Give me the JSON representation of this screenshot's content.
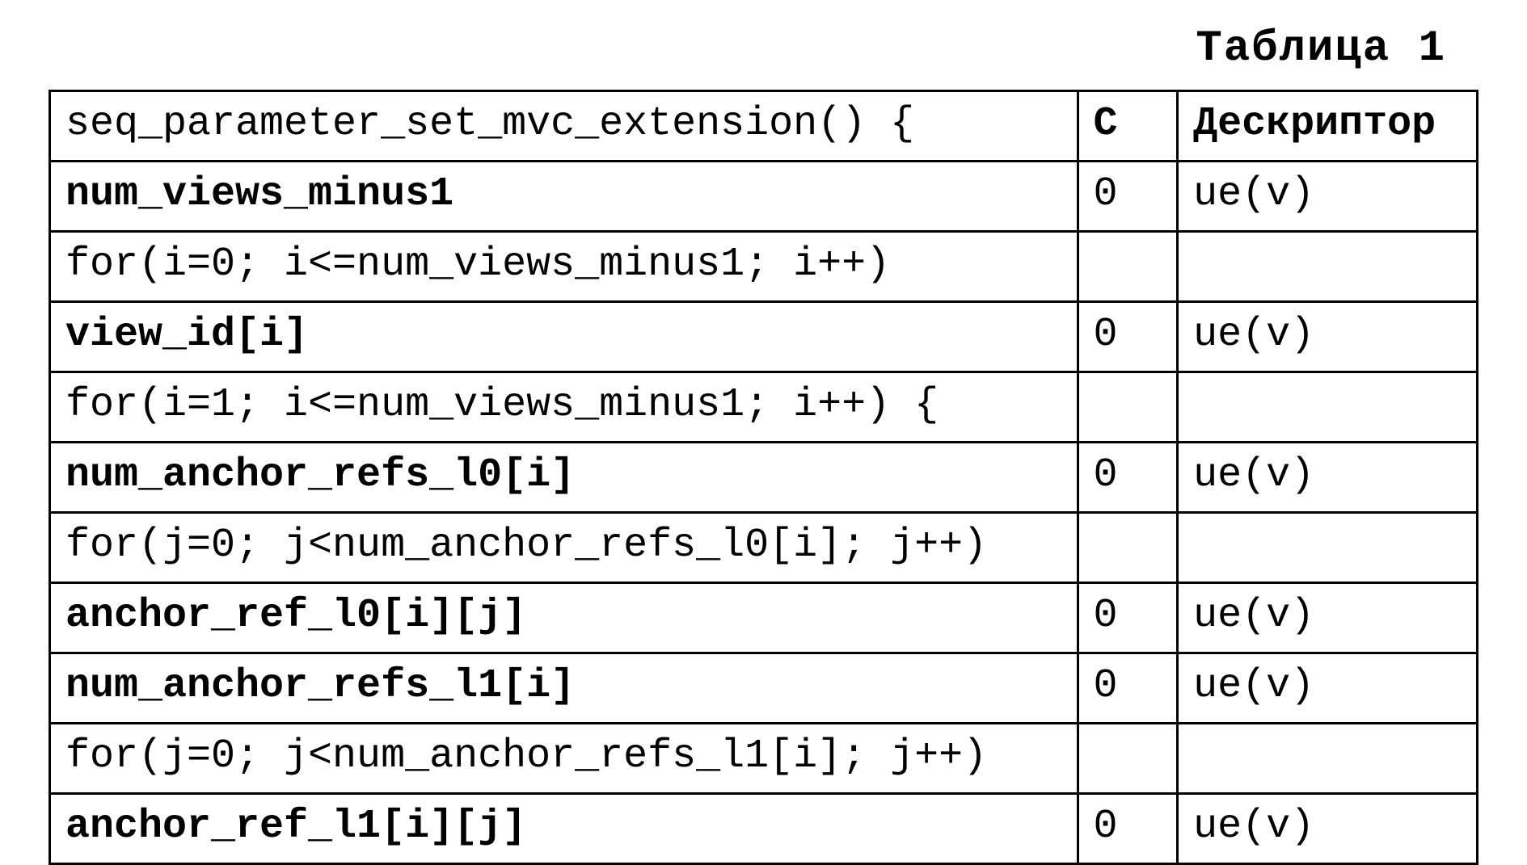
{
  "table_label": "Таблица 1",
  "headers": {
    "syntax": "seq_parameter_set_mvc_extension() {",
    "c": "C",
    "descriptor": "Дескриптор"
  },
  "rows": [
    {
      "syntax": "num_views_minus1",
      "c": "0",
      "descriptor": "ue(v)",
      "bold": true
    },
    {
      "syntax": "for(i=0; i<=num_views_minus1; i++)",
      "c": "",
      "descriptor": "",
      "bold": false
    },
    {
      "syntax": "view_id[i]",
      "c": "0",
      "descriptor": "ue(v)",
      "bold": true
    },
    {
      "syntax": "for(i=1; i<=num_views_minus1; i++) {",
      "c": "",
      "descriptor": "",
      "bold": false
    },
    {
      "syntax": "num_anchor_refs_l0[i]",
      "c": "0",
      "descriptor": "ue(v)",
      "bold": true
    },
    {
      "syntax": "for(j=0; j<num_anchor_refs_l0[i]; j++)",
      "c": "",
      "descriptor": "",
      "bold": false
    },
    {
      "syntax": "anchor_ref_l0[i][j]",
      "c": "0",
      "descriptor": "ue(v)",
      "bold": true
    },
    {
      "syntax": "num_anchor_refs_l1[i]",
      "c": "0",
      "descriptor": "ue(v)",
      "bold": true
    },
    {
      "syntax": "for(j=0; j<num_anchor_refs_l1[i]; j++)",
      "c": "",
      "descriptor": "",
      "bold": false
    },
    {
      "syntax": "anchor_ref_l1[i][j]",
      "c": "0",
      "descriptor": "ue(v)",
      "bold": true
    }
  ]
}
